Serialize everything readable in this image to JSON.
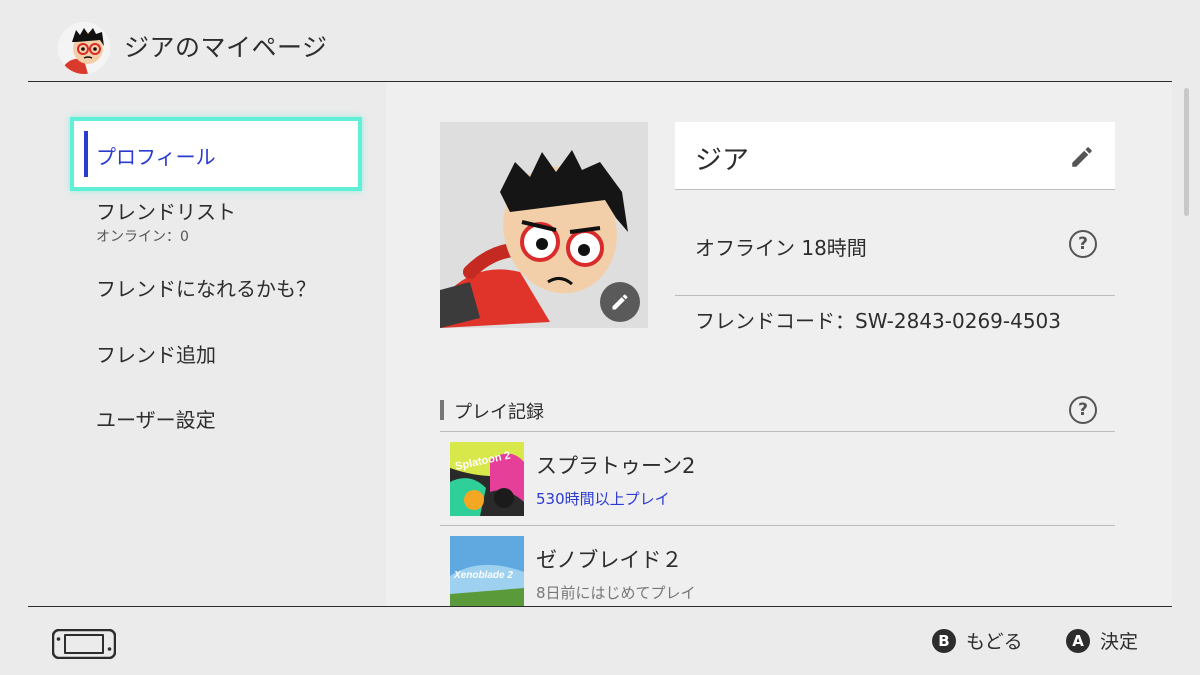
{
  "header": {
    "title": "ジアのマイページ",
    "avatar_icon": "mii-avatar-icon"
  },
  "sidebar": {
    "selected": "プロフィール",
    "items": [
      {
        "label": "プロフィール"
      },
      {
        "label": "フレンドリスト",
        "sub": "オンライン：0"
      },
      {
        "label": "フレンドになれるかも？"
      },
      {
        "label": "フレンド追加"
      },
      {
        "label": "ユーザー設定"
      }
    ]
  },
  "profile": {
    "name": "ジア",
    "status": "オフライン 18時間",
    "friend_code": "フレンドコード：SW-2843-0269-4503",
    "edit_icon": "pencil-icon",
    "help_icon": "question-mark-icon"
  },
  "play_records": {
    "heading": "プレイ記録",
    "games": [
      {
        "title": "スプラトゥーン2",
        "detail": "530時間以上プレイ",
        "detail_color": "#2a3bd0",
        "thumb_text": "Splatoon 2"
      },
      {
        "title": "ゼノブレイド２",
        "detail": "8日前にはじめてプレイ",
        "detail_color": "#777777",
        "thumb_text": "Xenoblade 2"
      }
    ]
  },
  "footer": {
    "console_icon": "switch-console-icon",
    "back_button": "B",
    "back_label": "もどる",
    "ok_button": "A",
    "ok_label": "決定"
  },
  "colors": {
    "accent": "#2a3bd0",
    "focus_border": "#60f0d7",
    "background": "#ebebeb"
  }
}
